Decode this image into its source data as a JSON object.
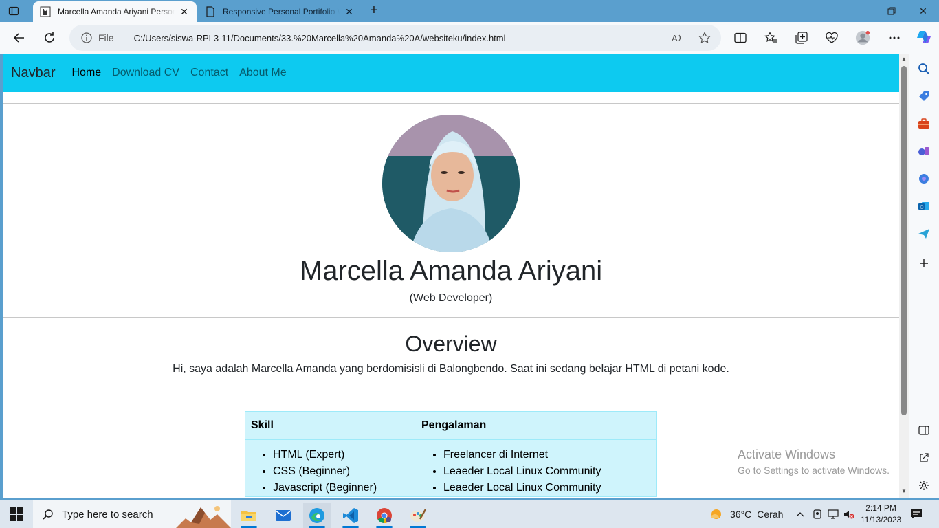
{
  "browser": {
    "tabs": [
      {
        "title": "Marcella Amanda Ariyani Personal Website",
        "active": true
      },
      {
        "title": "Responsive Personal Portifolio Website",
        "active": false
      }
    ],
    "address": {
      "scheme_label": "File",
      "url": "C:/Users/siswa-RPL3-11/Documents/33.%20Marcella%20Amanda%20A/websiteku/index.html"
    }
  },
  "site": {
    "navbar": {
      "brand": "Navbar",
      "links": [
        "Home",
        "Download CV",
        "Contact",
        "About Me"
      ]
    },
    "hero": {
      "name": "Marcella Amanda Ariyani",
      "role": "(Web Developer)"
    },
    "overview": {
      "title": "Overview",
      "text": "Hi, saya adalah Marcella Amanda yang berdomisisli di Balongbendo. Saat ini sedang belajar HTML di petani kode."
    },
    "table": {
      "headers": [
        "Skill",
        "Pengalaman"
      ],
      "skills": [
        "HTML (Expert)",
        "CSS (Beginner)",
        "Javascript (Beginner)"
      ],
      "experience": [
        "Freelancer di Internet",
        "Leaeder Local Linux Community",
        "Leaeder Local Linux Community"
      ]
    }
  },
  "watermark": {
    "line1": "Activate Windows",
    "line2": "Go to Settings to activate Windows."
  },
  "taskbar": {
    "search_placeholder": "Type here to search",
    "weather": {
      "temp": "36°C",
      "condition": "Cerah"
    },
    "clock": {
      "time": "2:14 PM",
      "date": "11/13/2023"
    }
  },
  "colors": {
    "navbar_bg": "#0dcaf0",
    "table_bg": "#cff4fc",
    "chrome": "#5a9fce"
  }
}
